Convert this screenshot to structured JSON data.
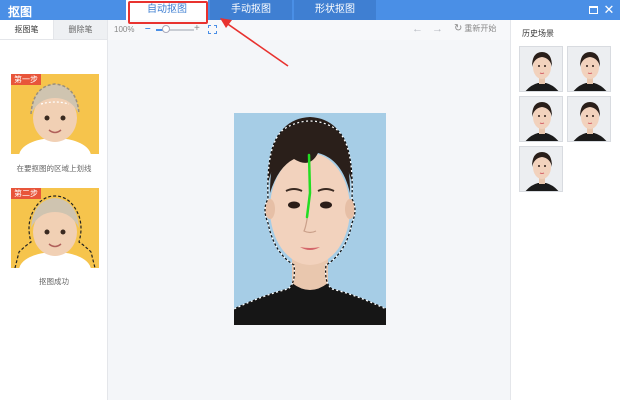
{
  "app": {
    "title": "抠图"
  },
  "tabs": [
    {
      "label": "自动抠图",
      "active": true
    },
    {
      "label": "手动抠图",
      "active": false
    },
    {
      "label": "形状抠图",
      "active": false
    }
  ],
  "left_panel": {
    "tabs": [
      {
        "label": "抠图笔",
        "active": true
      },
      {
        "label": "删除笔",
        "active": false
      }
    ],
    "steps": [
      {
        "badge": "第一步",
        "caption": "在要抠图的区域上划线"
      },
      {
        "badge": "第二步",
        "caption": "抠图成功"
      }
    ]
  },
  "toolbar": {
    "zoom_label": "100%",
    "zoom_level": 0.25,
    "reset_label": "重新开始"
  },
  "history": {
    "title": "历史场景",
    "count": 5
  },
  "colors": {
    "title_bar": "#4a8fe6",
    "photo_background": "#a6cde6",
    "brush_stroke": "#22dd22",
    "highlight": "#e8322f",
    "step_card": "#f6c44c"
  },
  "icons": [
    "maximize-icon",
    "close-icon",
    "zoom-minus-icon",
    "zoom-plus-icon",
    "fit-screen-icon",
    "undo-icon",
    "redo-icon",
    "reset-icon"
  ]
}
